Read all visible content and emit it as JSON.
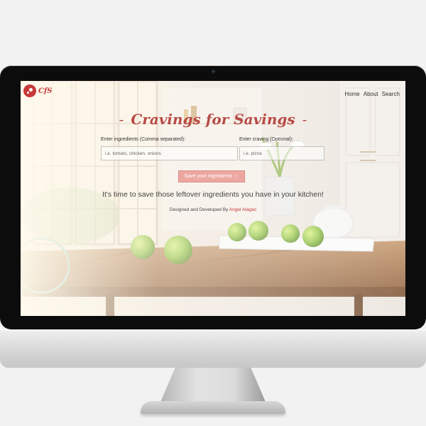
{
  "app": {
    "logo_text": "CfS",
    "title_part1": "Cravings for Savings",
    "title_dash": "-"
  },
  "nav": {
    "items": [
      "Home",
      "About",
      "Search"
    ]
  },
  "form": {
    "ingredients_label": "Enter ingredients (Comma separated):",
    "ingredients_placeholder": "i.e. tomato, chicken, onions",
    "craving_label": "Enter craving (Optional):",
    "craving_placeholder": "i.e. pizza",
    "save_label": "Save your ingredients"
  },
  "hero": {
    "tagline": "It's time to save those leftover ingredients you have in your kitchen!",
    "credit_prefix": "Designed and Developed By ",
    "credit_name": "Angel Alagao"
  },
  "colors": {
    "accent": "#b84a46",
    "button": "#e88d87"
  },
  "icons": {
    "save_icon": "heart-outline-icon",
    "logo_icon": "cookie-icon"
  }
}
